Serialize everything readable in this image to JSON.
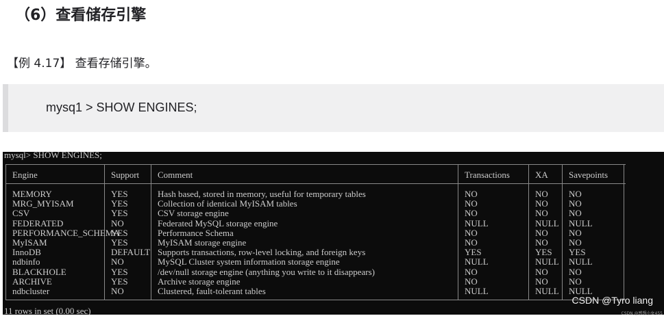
{
  "heading": "（6）查看储存引擎",
  "example": "【例 4.17】 查看存储引擎。",
  "code": "mysq1 > SHOW ENGINES;",
  "terminal": {
    "command": "mysql> SHOW ENGINES;",
    "headers": [
      "Engine",
      "Support",
      "Comment",
      "Transactions",
      "XA",
      "Savepoints"
    ],
    "rows": [
      [
        "MEMORY",
        "YES",
        "Hash based, stored in memory, useful for temporary tables",
        "NO",
        "NO",
        "NO"
      ],
      [
        "MRG_MYISAM",
        "YES",
        "Collection of identical MyISAM tables",
        "NO",
        "NO",
        "NO"
      ],
      [
        "CSV",
        "YES",
        "CSV storage engine",
        "NO",
        "NO",
        "NO"
      ],
      [
        "FEDERATED",
        "NO",
        "Federated MySQL storage engine",
        "NULL",
        "NULL",
        "NULL"
      ],
      [
        "PERFORMANCE_SCHEMA",
        "YES",
        "Performance Schema",
        "NO",
        "NO",
        "NO"
      ],
      [
        "MyISAM",
        "YES",
        "MyISAM storage engine",
        "NO",
        "NO",
        "NO"
      ],
      [
        "InnoDB",
        "DEFAULT",
        "Supports transactions, row-level locking, and foreign keys",
        "YES",
        "YES",
        "YES"
      ],
      [
        "ndbinfo",
        "NO",
        "MySQL Cluster system information storage engine",
        "NULL",
        "NULL",
        "NULL"
      ],
      [
        "BLACKHOLE",
        "YES",
        "/dev/null storage engine (anything you write to it disappears)",
        "NO",
        "NO",
        "NO"
      ],
      [
        "ARCHIVE",
        "YES",
        "Archive storage engine",
        "NO",
        "NO",
        "NO"
      ],
      [
        "ndbcluster",
        "NO",
        "Clustered, fault-tolerant tables",
        "NULL",
        "NULL",
        "NULL"
      ]
    ],
    "footer": "11 rows in set (0.00 sec)"
  },
  "watermark": "CSDN @Tyro liang",
  "watermark_small": "CSDN @感想小女455"
}
